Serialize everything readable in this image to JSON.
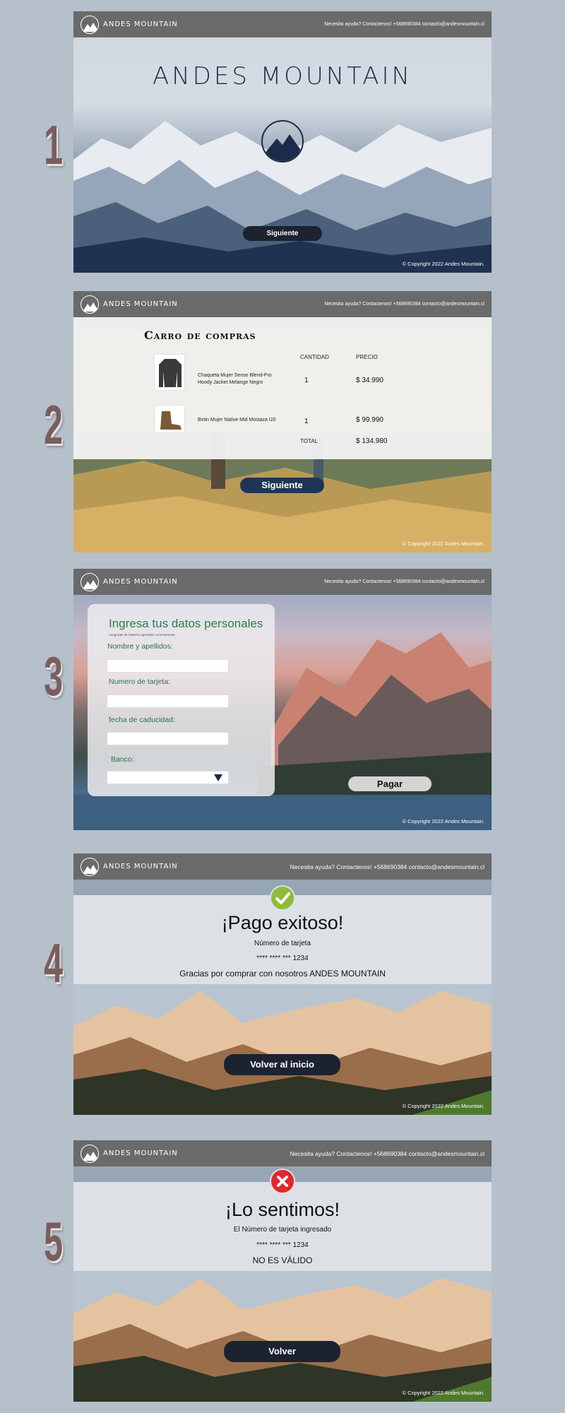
{
  "common": {
    "brand": "ANDES MOUNTAIN",
    "contact": "Necesita ayuda? Contactenos! +568690384  contacto@andesmountain.cl",
    "copyright": "© Copyright  2022 Andes Mountain."
  },
  "steps": [
    "1",
    "2",
    "3",
    "4",
    "5"
  ],
  "screen1": {
    "title": "ANDES MOUNTAIN",
    "next_button": "Siguiente"
  },
  "screen2": {
    "title": "Carro de compras",
    "col_quantity": "CANTIDAD",
    "col_price": "PRECIO",
    "items": [
      {
        "name": "Chaqueta Mujer Sense Blend-Pro Hoody Jacket Melange Negro",
        "qty": "1",
        "price": "$ 34.990"
      },
      {
        "name": "Botin Mujer Native Mid Mostaza I20",
        "qty": "1",
        "price": "$ 99.990"
      }
    ],
    "total_label": "TOTAL",
    "total_value": "$ 134.980",
    "next_button": "Siguiente"
  },
  "screen3": {
    "title": "Ingresa tus datos personales",
    "subtitle": "Asegurate de haberlo ingresado correctamente",
    "name_label": "Nombre y apellidos:",
    "card_label": "Numero de tarjeta:",
    "expiry_label": "fecha de caducidad:",
    "bank_label": "Banco:",
    "pay_button": "Pagar"
  },
  "screen4": {
    "title": "¡Pago exitoso!",
    "card_label": "Número de tarjeta",
    "card_masked": "****  ****  ***  1234",
    "thanks": "Gracias por comprar con nosotros ANDES MOUNTAIN",
    "home_button": "Volver al inicio"
  },
  "screen5": {
    "title": "¡Lo sentimos!",
    "card_label": "El Número de tarjeta ingresado",
    "card_masked": "****  ****  ***  1234",
    "invalid": "NO ES VÁLIDO",
    "back_button": "Volver"
  },
  "colors": {
    "topbar": "#6a6a6a",
    "navy": "#1c2b4a",
    "success": "#8cbc3a",
    "error": "#e8232a",
    "form_green": "#2f7f46"
  }
}
